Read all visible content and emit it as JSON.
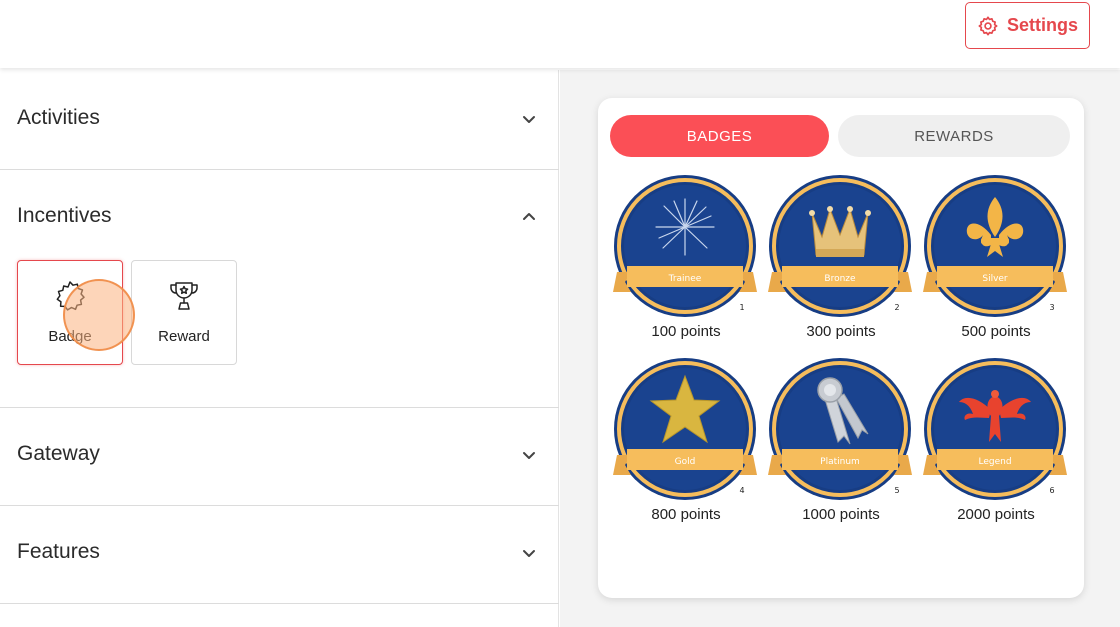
{
  "header": {
    "settings_label": "Settings",
    "settings_icon": "gear-icon",
    "accent_color": "#e5484d"
  },
  "sidebar": {
    "sections": [
      {
        "title": "Activities",
        "expanded": false
      },
      {
        "title": "Incentives",
        "expanded": true
      },
      {
        "title": "Gateway",
        "expanded": false
      },
      {
        "title": "Features",
        "expanded": false
      }
    ],
    "incentive_tiles": [
      {
        "label": "Badge",
        "icon": "badge-icon",
        "selected": true
      },
      {
        "label": "Reward",
        "icon": "trophy-icon",
        "selected": false
      }
    ]
  },
  "preview": {
    "tabs": [
      {
        "label": "BADGES",
        "active": true
      },
      {
        "label": "REWARDS",
        "active": false
      }
    ],
    "badges": [
      {
        "name": "Trainee",
        "number": "1",
        "points": "100 points",
        "art": "fireworks"
      },
      {
        "name": "Bronze",
        "number": "2",
        "points": "300 points",
        "art": "crown"
      },
      {
        "name": "Silver",
        "number": "3",
        "points": "500 points",
        "art": "fleur-de-lis"
      },
      {
        "name": "Gold",
        "number": "4",
        "points": "800 points",
        "art": "star"
      },
      {
        "name": "Platinum",
        "number": "5",
        "points": "1000 points",
        "art": "medal-ribbon"
      },
      {
        "name": "Legend",
        "number": "6",
        "points": "2000 points",
        "art": "phoenix"
      }
    ],
    "colors": {
      "tab_active": "#fb4f56",
      "badge_navy": "#173d84",
      "badge_gold": "#f6bd5c"
    }
  }
}
